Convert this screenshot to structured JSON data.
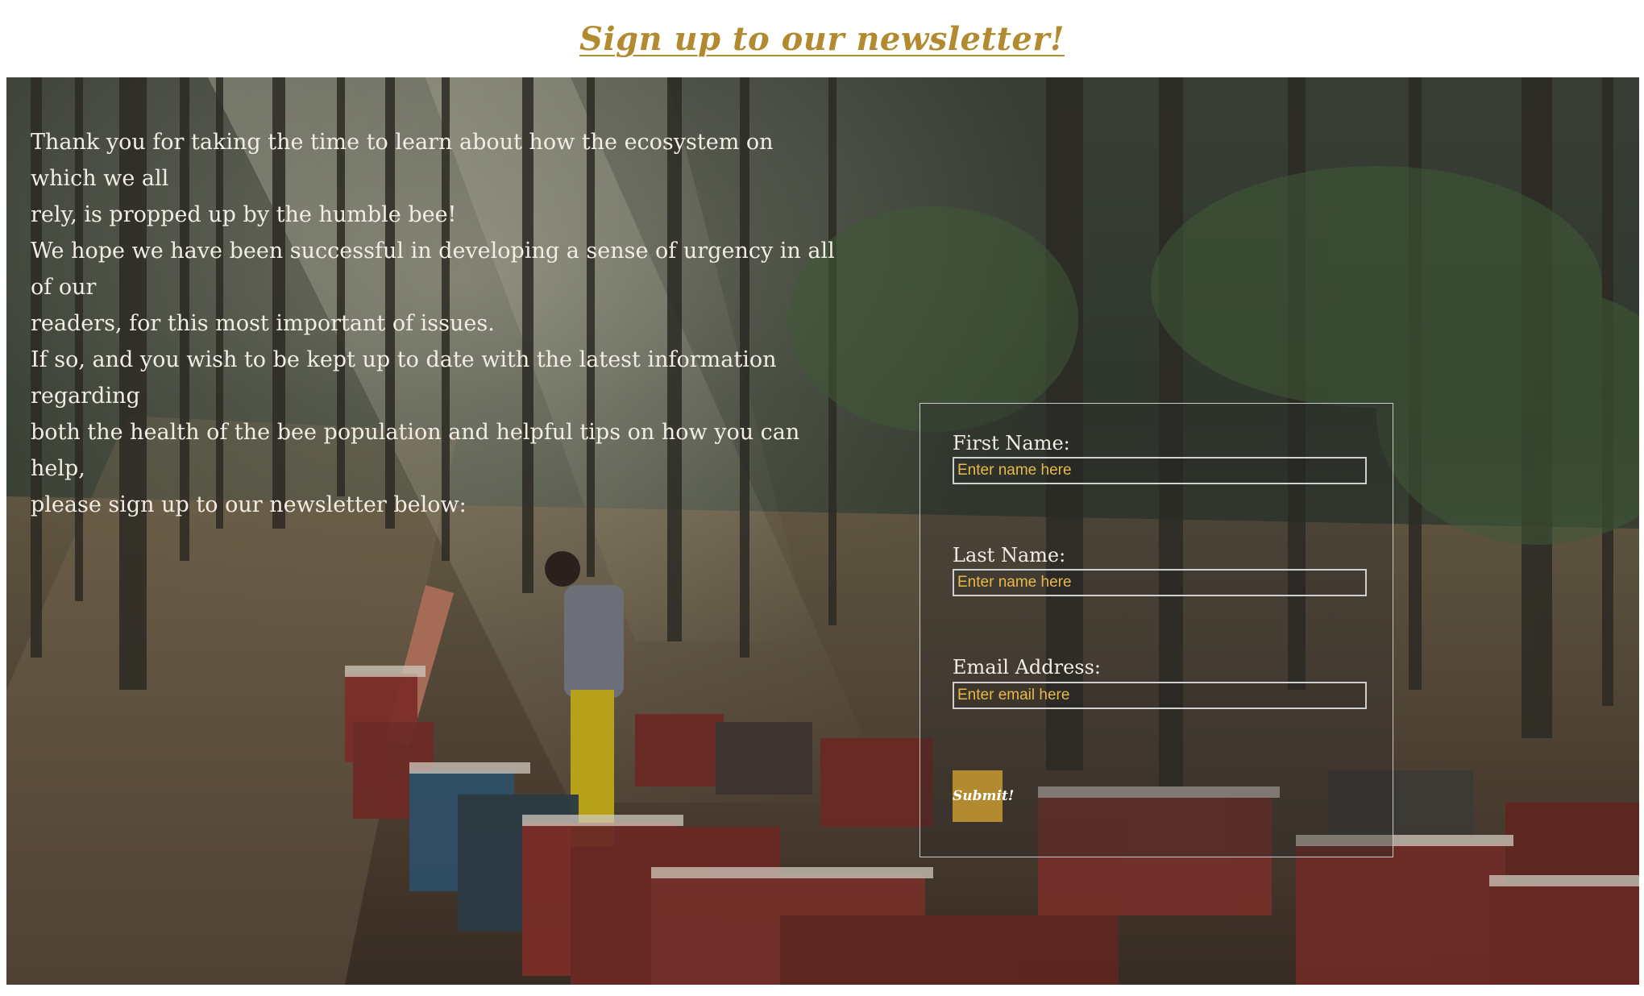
{
  "header": {
    "title": "Sign up to our newsletter!"
  },
  "intro": {
    "lines": [
      "Thank you for taking the time to learn about how the ecosystem on which we all",
      "rely, is propped up by the humble bee!",
      "We hope we have been successful in developing a sense of urgency in all of our",
      "readers, for this most important of issues.",
      "If so, and you wish to be kept up to date with the latest information regarding",
      "both the health of the bee population and helpful tips on how you can help,",
      "please sign up to our newsletter below:"
    ]
  },
  "form": {
    "first_name_label": "First Name:",
    "first_name_placeholder": "Enter name here",
    "last_name_label": "Last Name:",
    "last_name_placeholder": "Enter name here",
    "email_label": "Email Address:",
    "email_placeholder": "Enter email here",
    "submit_label": "Submit!"
  },
  "colors": {
    "accent": "#b28a2f",
    "placeholder": "#e9b84a",
    "text_light": "#f1ede4"
  }
}
